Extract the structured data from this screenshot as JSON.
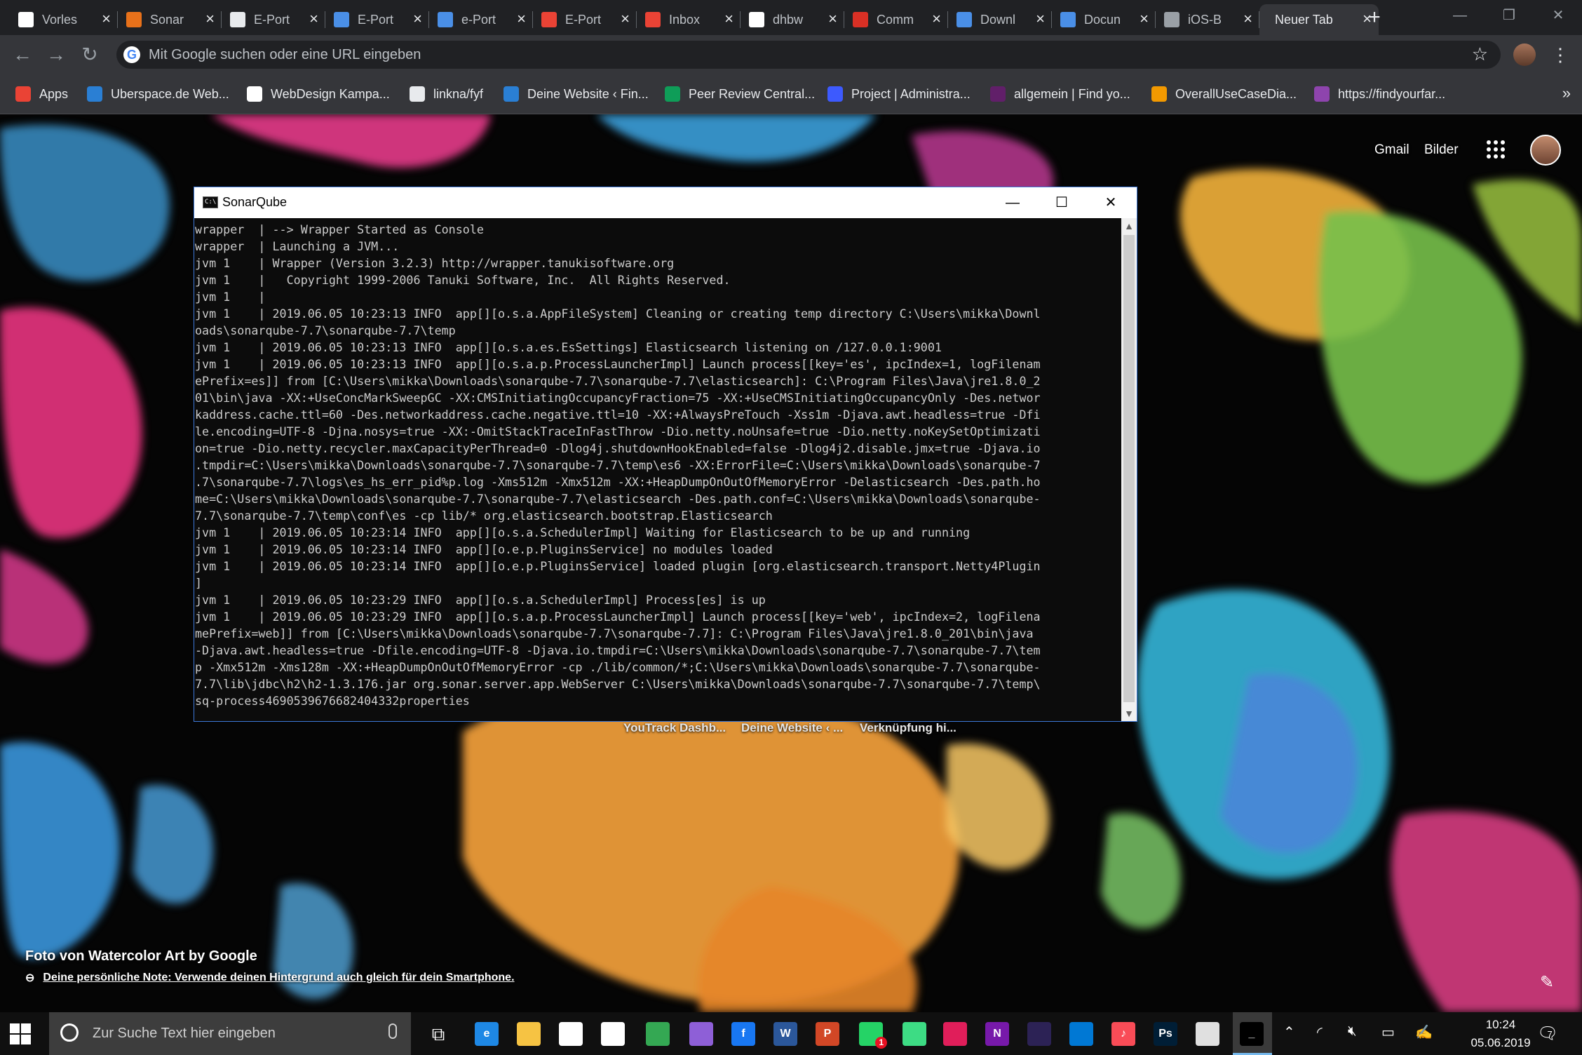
{
  "tabs": [
    {
      "label": "Vorles",
      "icon": "doc-icon",
      "color": "#ffffff"
    },
    {
      "label": "Sonar",
      "icon": "sonar-icon",
      "color": "#e8711a"
    },
    {
      "label": "E-Port",
      "icon": "github-icon",
      "color": "#e8eaed"
    },
    {
      "label": "E-Port",
      "icon": "pb-icon",
      "color": "#4a8fe7"
    },
    {
      "label": "e-Port",
      "icon": "pb-icon",
      "color": "#4a8fe7"
    },
    {
      "label": "E-Port",
      "icon": "gmail-icon",
      "color": "#ea4335"
    },
    {
      "label": "Inbox",
      "icon": "gmail-icon",
      "color": "#ea4335"
    },
    {
      "label": "dhbw",
      "icon": "pb-icon",
      "color": "#ffffff"
    },
    {
      "label": "Comm",
      "icon": "swoosh-icon",
      "color": "#d93025"
    },
    {
      "label": "Downl",
      "icon": "swoosh-icon",
      "color": "#4a8fe7"
    },
    {
      "label": "Docun",
      "icon": "swoosh-icon",
      "color": "#4a8fe7"
    },
    {
      "label": "iOS-B",
      "icon": "apple-icon",
      "color": "#9aa0a6"
    },
    {
      "label": "Neuer Tab",
      "icon": "",
      "color": "",
      "active": true
    }
  ],
  "omnibox": {
    "placeholder": "Mit Google suchen oder eine URL eingeben"
  },
  "bookmarks": [
    {
      "label": "Apps",
      "icon": "apps-grid-icon",
      "color": "#ea4335"
    },
    {
      "label": "Uberspace.de Web...",
      "icon": "globe-icon",
      "color": "#2a7fd4"
    },
    {
      "label": "WebDesign Kampa...",
      "icon": "site-icon",
      "color": "#ffffff"
    },
    {
      "label": "linkna/fyf",
      "icon": "github-icon",
      "color": "#e8eaed"
    },
    {
      "label": "Deine Website ‹ Fin...",
      "icon": "wordpress-icon",
      "color": "#2a7fd4"
    },
    {
      "label": "Peer Review Central...",
      "icon": "plus-icon",
      "color": "#0f9d58"
    },
    {
      "label": "Project | Administra...",
      "icon": "project-icon",
      "color": "#3d5afe"
    },
    {
      "label": "allgemein | Find yo...",
      "icon": "slack-hash-icon",
      "color": "#611f69"
    },
    {
      "label": "OverallUseCaseDia...",
      "icon": "diagram-icon",
      "color": "#f29900"
    },
    {
      "label": "https://findyourfar...",
      "icon": "yt-icon",
      "color": "#8e44ad"
    }
  ],
  "ntp": {
    "gmail": "Gmail",
    "images": "Bilder",
    "tiles": [
      "YouTrack Dashb...",
      "Deine Website ‹ ...",
      "Verknüpfung hi..."
    ],
    "attribution_title": "Foto von Watercolor Art by Google",
    "attribution_link": "Deine persönliche Note: Verwende deinen Hintergrund auch gleich für dein Smartphone."
  },
  "console": {
    "title": "SonarQube",
    "lines": [
      "wrapper  | --> Wrapper Started as Console",
      "wrapper  | Launching a JVM...",
      "jvm 1    | Wrapper (Version 3.2.3) http://wrapper.tanukisoftware.org",
      "jvm 1    |   Copyright 1999-2006 Tanuki Software, Inc.  All Rights Reserved.",
      "jvm 1    |",
      "jvm 1    | 2019.06.05 10:23:13 INFO  app[][o.s.a.AppFileSystem] Cleaning or creating temp directory C:\\Users\\mikka\\Downl",
      "oads\\sonarqube-7.7\\sonarqube-7.7\\temp",
      "jvm 1    | 2019.06.05 10:23:13 INFO  app[][o.s.a.es.EsSettings] Elasticsearch listening on /127.0.0.1:9001",
      "jvm 1    | 2019.06.05 10:23:13 INFO  app[][o.s.a.p.ProcessLauncherImpl] Launch process[[key='es', ipcIndex=1, logFilenam",
      "ePrefix=es]] from [C:\\Users\\mikka\\Downloads\\sonarqube-7.7\\sonarqube-7.7\\elasticsearch]: C:\\Program Files\\Java\\jre1.8.0_2",
      "01\\bin\\java -XX:+UseConcMarkSweepGC -XX:CMSInitiatingOccupancyFraction=75 -XX:+UseCMSInitiatingOccupancyOnly -Des.networ",
      "kaddress.cache.ttl=60 -Des.networkaddress.cache.negative.ttl=10 -XX:+AlwaysPreTouch -Xss1m -Djava.awt.headless=true -Dfi",
      "le.encoding=UTF-8 -Djna.nosys=true -XX:-OmitStackTraceInFastThrow -Dio.netty.noUnsafe=true -Dio.netty.noKeySetOptimizati",
      "on=true -Dio.netty.recycler.maxCapacityPerThread=0 -Dlog4j.shutdownHookEnabled=false -Dlog4j2.disable.jmx=true -Djava.io",
      ".tmpdir=C:\\Users\\mikka\\Downloads\\sonarqube-7.7\\sonarqube-7.7\\temp\\es6 -XX:ErrorFile=C:\\Users\\mikka\\Downloads\\sonarqube-7",
      ".7\\sonarqube-7.7\\logs\\es_hs_err_pid%p.log -Xms512m -Xmx512m -XX:+HeapDumpOnOutOfMemoryError -Delasticsearch -Des.path.ho",
      "me=C:\\Users\\mikka\\Downloads\\sonarqube-7.7\\sonarqube-7.7\\elasticsearch -Des.path.conf=C:\\Users\\mikka\\Downloads\\sonarqube-",
      "7.7\\sonarqube-7.7\\temp\\conf\\es -cp lib/* org.elasticsearch.bootstrap.Elasticsearch",
      "jvm 1    | 2019.06.05 10:23:14 INFO  app[][o.s.a.SchedulerImpl] Waiting for Elasticsearch to be up and running",
      "jvm 1    | 2019.06.05 10:23:14 INFO  app[][o.e.p.PluginsService] no modules loaded",
      "jvm 1    | 2019.06.05 10:23:14 INFO  app[][o.e.p.PluginsService] loaded plugin [org.elasticsearch.transport.Netty4Plugin",
      "]",
      "jvm 1    | 2019.06.05 10:23:29 INFO  app[][o.s.a.SchedulerImpl] Process[es] is up",
      "jvm 1    | 2019.06.05 10:23:29 INFO  app[][o.s.a.p.ProcessLauncherImpl] Launch process[[key='web', ipcIndex=2, logFilena",
      "mePrefix=web]] from [C:\\Users\\mikka\\Downloads\\sonarqube-7.7\\sonarqube-7.7]: C:\\Program Files\\Java\\jre1.8.0_201\\bin\\java",
      "-Djava.awt.headless=true -Dfile.encoding=UTF-8 -Djava.io.tmpdir=C:\\Users\\mikka\\Downloads\\sonarqube-7.7\\sonarqube-7.7\\tem",
      "p -Xmx512m -Xms128m -XX:+HeapDumpOnOutOfMemoryError -cp ./lib/common/*;C:\\Users\\mikka\\Downloads\\sonarqube-7.7\\sonarqube-",
      "7.7\\lib\\jdbc\\h2\\h2-1.3.176.jar org.sonar.server.app.WebServer C:\\Users\\mikka\\Downloads\\sonarqube-7.7\\sonarqube-7.7\\temp\\",
      "sq-process4690539676682404332properties"
    ]
  },
  "taskbar": {
    "search_placeholder": "Zur Suche Text hier eingeben",
    "apps": [
      {
        "name": "edge-icon",
        "color": "#1e88e5",
        "glyph": "e"
      },
      {
        "name": "file-explorer-icon",
        "color": "#f6c343",
        "glyph": ""
      },
      {
        "name": "mail-icon",
        "color": "#ffffff",
        "glyph": ""
      },
      {
        "name": "store-icon",
        "color": "#ffffff",
        "glyph": ""
      },
      {
        "name": "chrome-icon",
        "color": "#34a853",
        "glyph": ""
      },
      {
        "name": "visual-studio-icon",
        "color": "#8e5fd7",
        "glyph": ""
      },
      {
        "name": "facebook-icon",
        "color": "#1877f2",
        "glyph": "f"
      },
      {
        "name": "word-icon",
        "color": "#2b579a",
        "glyph": "W"
      },
      {
        "name": "powerpoint-icon",
        "color": "#d24726",
        "glyph": "P"
      },
      {
        "name": "whatsapp-icon",
        "color": "#25d366",
        "glyph": "",
        "badge": "1"
      },
      {
        "name": "android-studio-icon",
        "color": "#3ddc84",
        "glyph": ""
      },
      {
        "name": "slack-icon",
        "color": "#e01e5a",
        "glyph": ""
      },
      {
        "name": "onenote-icon",
        "color": "#7719aa",
        "glyph": "N"
      },
      {
        "name": "eclipse-icon",
        "color": "#2c2255",
        "glyph": ""
      },
      {
        "name": "onedrive-icon",
        "color": "#0078d4",
        "glyph": ""
      },
      {
        "name": "itunes-icon",
        "color": "#f94c57",
        "glyph": "♪"
      },
      {
        "name": "photoshop-icon",
        "color": "#001e36",
        "glyph": "Ps"
      },
      {
        "name": "paint-icon",
        "color": "#e0e0e0",
        "glyph": ""
      },
      {
        "name": "cmd-icon",
        "color": "#000000",
        "glyph": "_"
      }
    ],
    "time": "10:24",
    "date": "05.06.2019",
    "notifications": "7"
  }
}
